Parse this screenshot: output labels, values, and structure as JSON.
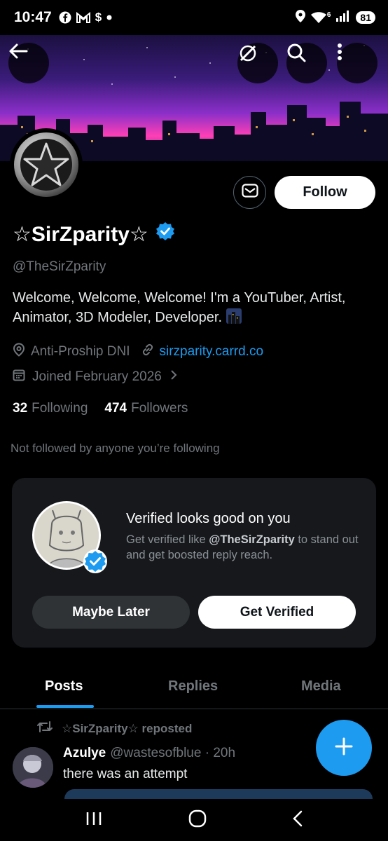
{
  "status": {
    "time": "10:47",
    "notif_icons": [
      "facebook-icon",
      "gmail-icon",
      "dollar-icon",
      "dot-icon"
    ],
    "dollar": "$",
    "network": "6",
    "battery": "81"
  },
  "header": {
    "back_icon": "arrow-left-icon",
    "actions": [
      "grok-icon",
      "search-icon",
      "more-vertical-icon"
    ]
  },
  "profile": {
    "name": "☆SirZparity☆",
    "handle": "@TheSirZparity",
    "bio": "Welcome, Welcome, Welcome! I'm a YouTuber, Artist, Animator, 3D Modeler, Developer.",
    "location": "Anti-Proship DNI",
    "website": "sirzparity.carrd.co",
    "joined": "Joined February 2026",
    "following_count": "32",
    "following_label": "Following",
    "followers_count": "474",
    "followers_label": "Followers",
    "not_followed_text": "Not followed by anyone you’re following",
    "follow_label": "Follow"
  },
  "verified_card": {
    "title": "Verified looks good on you",
    "subtitle_prefix": "Get verified like ",
    "subtitle_handle": "@TheSirZparity",
    "subtitle_suffix": " to stand out and get boosted reply reach.",
    "later_label": "Maybe Later",
    "verify_label": "Get Verified"
  },
  "tabs": [
    {
      "label": "Posts",
      "active": true
    },
    {
      "label": "Replies",
      "active": false
    },
    {
      "label": "Media",
      "active": false
    }
  ],
  "post": {
    "repost_label": "☆SirZparity☆ reposted",
    "author_name": "Azulye",
    "author_handle": "@wastesofblue",
    "time": "· 20h",
    "text": "there was an attempt"
  },
  "colors": {
    "accent": "#1d9bf0",
    "background": "#000000",
    "muted": "#71767b",
    "card": "#16181c"
  }
}
